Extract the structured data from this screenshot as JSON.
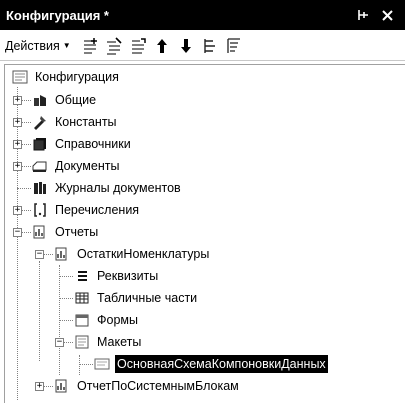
{
  "window": {
    "title": "Конфигурация *",
    "pin_glyph": "⊣",
    "close_glyph": "✕"
  },
  "toolbar": {
    "actions_label": "Действия",
    "tools": [
      "add-icon",
      "add-group-icon",
      "copy-icon",
      "move-up-icon",
      "move-down-icon",
      "hierarchy-icon",
      "filter-icon"
    ]
  },
  "tree": {
    "root": "Конфигурация",
    "items": [
      {
        "label": "Общие",
        "icon": "common-icon"
      },
      {
        "label": "Константы",
        "icon": "constants-icon"
      },
      {
        "label": "Справочники",
        "icon": "catalogs-icon"
      },
      {
        "label": "Документы",
        "icon": "documents-icon"
      },
      {
        "label": "Журналы документов",
        "icon": "document-journals-icon"
      },
      {
        "label": "Перечисления",
        "icon": "enumerations-icon"
      },
      {
        "label": "Отчеты",
        "icon": "reports-icon"
      },
      {
        "label": "ОстаткиНоменклатуры",
        "icon": "report-icon"
      },
      {
        "label": "Реквизиты",
        "icon": "attributes-icon"
      },
      {
        "label": "Табличные части",
        "icon": "tabular-sections-icon"
      },
      {
        "label": "Формы",
        "icon": "forms-icon"
      },
      {
        "label": "Макеты",
        "icon": "templates-icon"
      },
      {
        "label": "ОсновнаяСхемаКомпоновкиДанных",
        "icon": "template-icon"
      },
      {
        "label": "ОтчетПоСистемнымБлокам",
        "icon": "report-icon"
      }
    ]
  }
}
